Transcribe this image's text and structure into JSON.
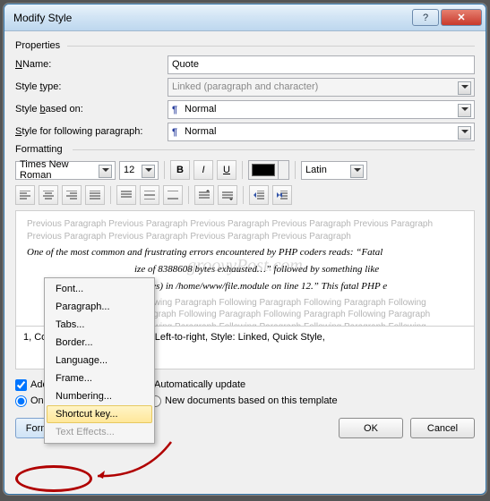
{
  "title": "Modify Style",
  "groups": {
    "properties": "Properties",
    "formatting": "Formatting"
  },
  "labels": {
    "name": "Name:",
    "style_type": "Style type:",
    "based_on": "Style based on:",
    "following": "Style for following paragraph:"
  },
  "fields": {
    "name_value": "Quote",
    "style_type_value": "Linked (paragraph and character)",
    "based_on_value": "Normal",
    "following_value": "Normal",
    "font_face": "Times New Roman",
    "font_size": "12",
    "script": "Latin"
  },
  "preview": {
    "ghost": "Previous Paragraph Previous Paragraph Previous Paragraph Previous Paragraph Previous Paragraph Previous Paragraph Previous Paragraph Previous Paragraph Previous Paragraph",
    "sample1": "One of the most common and frustrating errors encountered by PHP coders reads: “Fatal",
    "sample2": "ize of 8388608 bytes exhausted…” followed by something like",
    "sample3": "f bytes) in /home/www/file.module on line 12.” This fatal PHP e",
    "follow": "Following Paragraph Following Paragraph Following Paragraph Following Paragraph Following Paragraph Following Paragraph Following Paragraph Following Paragraph Following Paragraph Following Paragraph Following Paragraph Following Paragraph Following Paragraph Following Paragraph Following Paragraph Following Paragraph Following Paragraph Following Paragraph",
    "watermark": "groovyPost.com"
  },
  "description": "1, Complex Script Font: Italic, Left-to-right, Style: Linked, Quick Style,",
  "options": {
    "add_quick": "Add to Quick Style list",
    "auto_update": "Automatically update",
    "radio_doc": "Only in this document",
    "radio_tpl": "New documents based on this template"
  },
  "menu": {
    "font": "Font...",
    "paragraph": "Paragraph...",
    "tabs": "Tabs...",
    "border": "Border...",
    "language": "Language...",
    "frame": "Frame...",
    "numbering": "Numbering...",
    "shortcut": "Shortcut key...",
    "text_effects": "Text Effects..."
  },
  "buttons": {
    "format": "Format",
    "ok": "OK",
    "cancel": "Cancel"
  }
}
